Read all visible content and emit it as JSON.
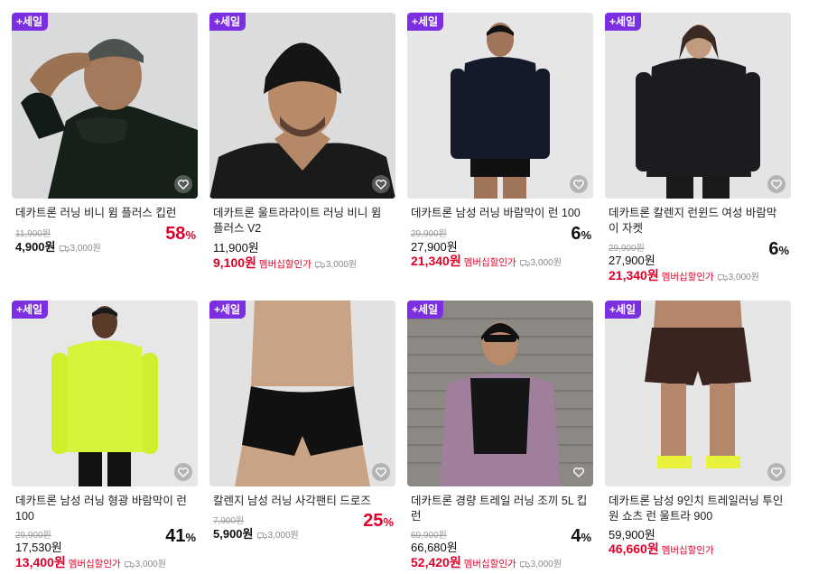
{
  "badge": "+세일",
  "products": [
    {
      "title": "데카트론 러닝 비니 윔 플러스 킵런",
      "orig": "11,900원",
      "price": "4,900원",
      "shipping": "3,000원",
      "member_price": "",
      "member_label": "",
      "rate": "58",
      "rate_color": "#e1002a"
    },
    {
      "title": "데카트론 울트라라이트 러닝 비니 윔 플러스 V2",
      "orig": "",
      "price": "11,900원",
      "shipping": "",
      "member_price": "9,100원",
      "member_label": "멤버십할인가",
      "member_shipping": "3,000원",
      "rate": "",
      "rate_color": "#111"
    },
    {
      "title": "데카트론 남성 러닝 바람막이 런 100",
      "orig": "29,900원",
      "price": "27,900원",
      "shipping": "",
      "member_price": "21,340원",
      "member_label": "멤버십할인가",
      "member_shipping": "3,000원",
      "rate": "6",
      "rate_color": "#111"
    },
    {
      "title": "데카트론 칼렌지 런윈드 여성 바람막이 자켓",
      "orig": "29,900원",
      "price": "27,900원",
      "shipping": "",
      "member_price": "21,340원",
      "member_label": "멤버십할인가",
      "member_shipping": "3,000원",
      "rate": "6",
      "rate_color": "#111"
    },
    {
      "title": "데카트론 남성 러닝 형광 바람막이 런 100",
      "orig": "29,900원",
      "price": "17,530원",
      "shipping": "",
      "member_price": "13,400원",
      "member_label": "멤버십할인가",
      "member_shipping": "3,000원",
      "rate": "41",
      "rate_color": "#111"
    },
    {
      "title": "칼렌지 남성 러닝 사각팬티 드로즈",
      "orig": "7,900원",
      "price": "5,900원",
      "shipping": "3,000원",
      "member_price": "",
      "member_label": "",
      "rate": "25",
      "rate_color": "#e1002a"
    },
    {
      "title": "데카트론 경량 트레일 러닝 조끼 5L 킵런",
      "orig": "69,900원",
      "price": "66,680원",
      "shipping": "",
      "member_price": "52,420원",
      "member_label": "멤버십할인가",
      "member_shipping": "3,000원",
      "rate": "4",
      "rate_color": "#111"
    },
    {
      "title": "데카트론 남성 9인치 트레일러닝 투인원 쇼츠 런 울트라 900",
      "orig": "",
      "price": "59,900원",
      "shipping": "",
      "member_price": "46,660원",
      "member_label": "멤버십할인가",
      "member_shipping": "",
      "rate": "",
      "rate_color": "#111"
    }
  ],
  "icons": {
    "favorite": "heart-icon",
    "shipping": "truck-icon"
  }
}
